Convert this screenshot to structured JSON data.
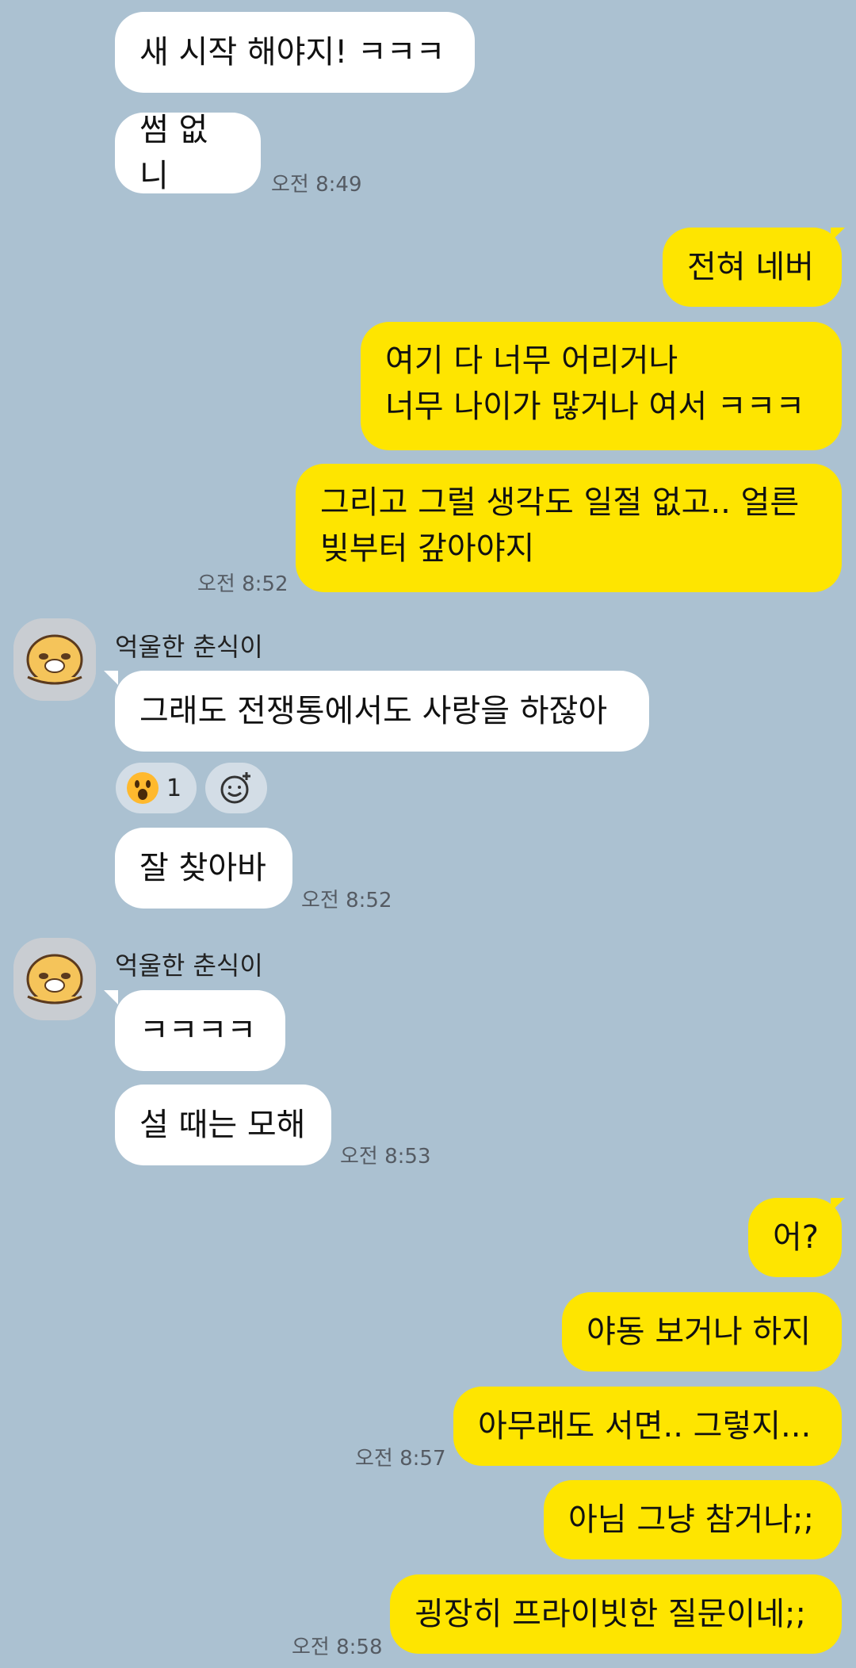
{
  "messages": {
    "m1": "새 시작 해야지! ㅋㅋㅋ",
    "m2": "썸 없니",
    "t1": "오전 8:49",
    "m3": "전혀 네버",
    "m4": "여기 다 너무 어리거나\n너무 나이가 많거나 여서 ㅋㅋㅋ",
    "m5": "그리고 그럴 생각도 일절 없고.. 얼른\n빚부터 갚아야지",
    "t2": "오전 8:52",
    "sender1": "억울한 춘식이",
    "m6": "그래도 전쟁통에서도 사랑을 하잖아",
    "reaction_count": "1",
    "m7": "잘 찾아바",
    "t3": "오전 8:52",
    "sender2": "억울한 춘식이",
    "m8": "ㅋㅋㅋㅋ",
    "m9": "설 때는 모해",
    "t4": "오전 8:53",
    "m10": "어?",
    "m11": "야동 보거나 하지",
    "m12": "아무래도 서면.. 그렇지...",
    "t5": "오전 8:57",
    "m13": "아님 그냥 참거나;;",
    "m14": "굉장히 프라이빗한 질문이네;;",
    "t6": "오전 8:58"
  },
  "icons": {
    "reaction_emoji": "surprised-face-emoji",
    "add_reaction": "add-reaction-icon",
    "avatar": "chunsik-character-avatar"
  },
  "colors": {
    "background": "#abc1d1",
    "incoming_bubble": "#ffffff",
    "outgoing_bubble": "#fee500"
  }
}
